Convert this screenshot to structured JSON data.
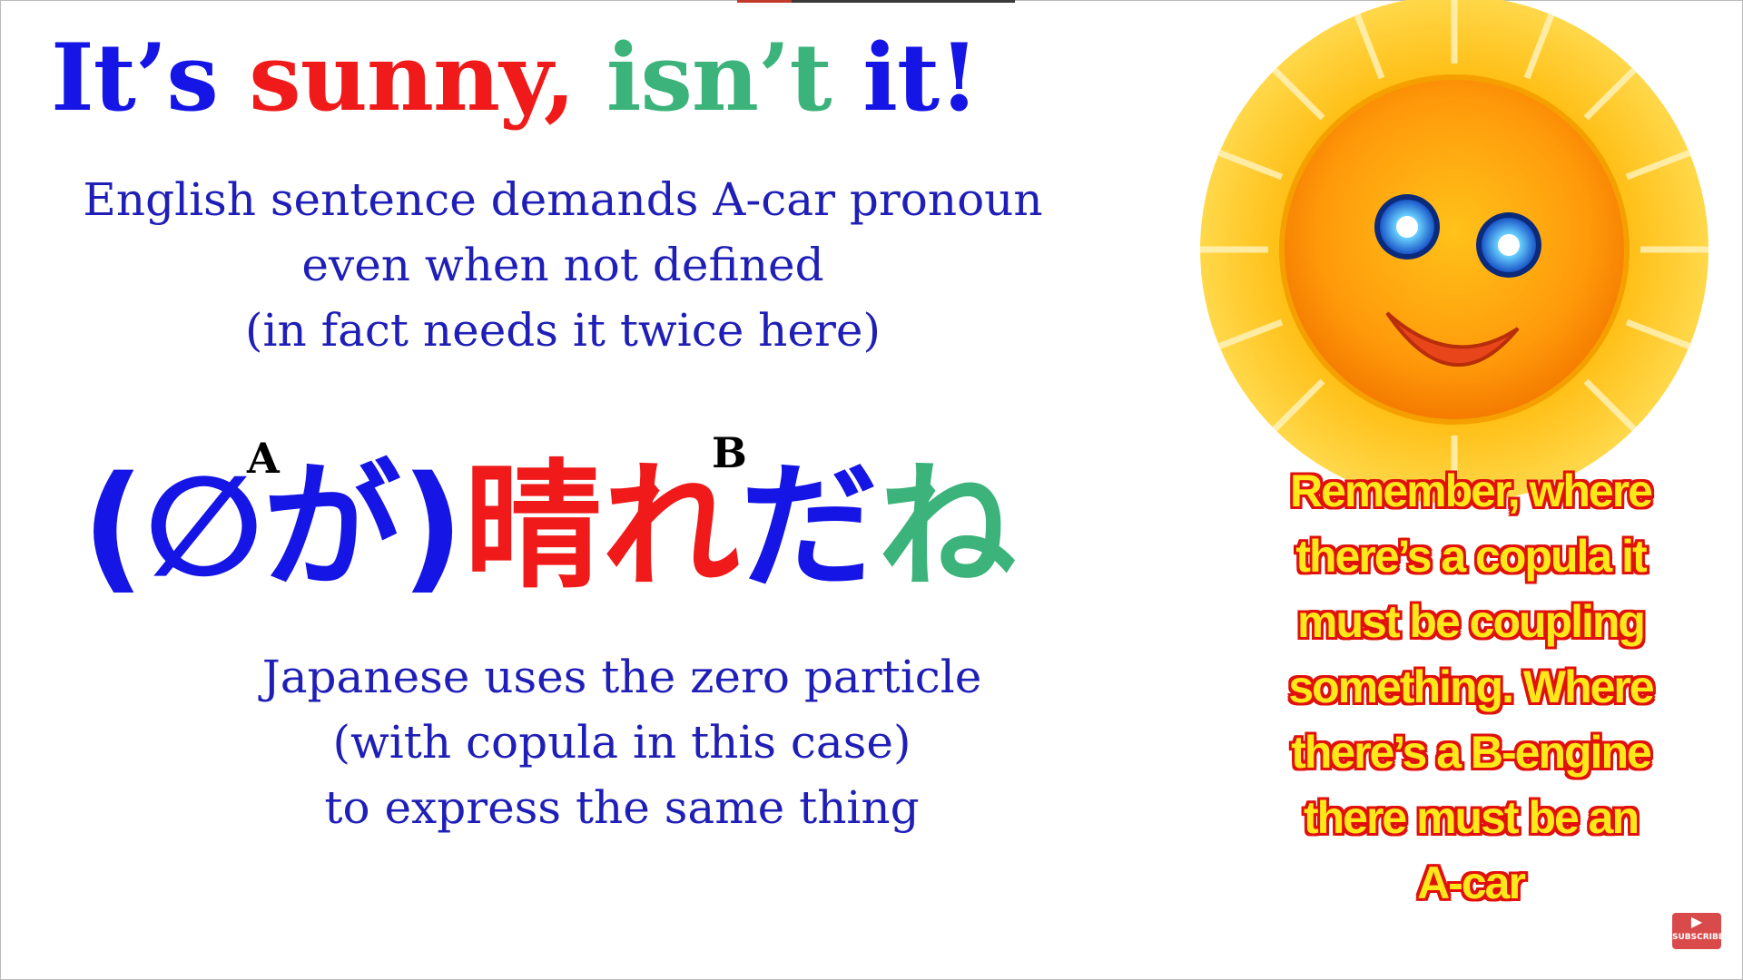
{
  "title": {
    "part1": "It’s",
    "part2": "sunny,",
    "part3": "isn’t",
    "part4": "it!"
  },
  "english_note": {
    "line1": "English sentence demands A-car pronoun",
    "line2": "even when not defined",
    "line3": "(in fact needs it twice here)"
  },
  "japanese_sentence": {
    "open_paren": "(",
    "zero_particle": "∅",
    "ga": "が",
    "close_paren": ")",
    "hare": "晴れ",
    "da": "だ",
    "ne": "ね",
    "marker_a": "A",
    "marker_b": "B"
  },
  "japanese_note": {
    "line1": "Japanese uses the zero particle",
    "line2": "(with copula in this case)",
    "line3": "to express the same thing"
  },
  "callout": {
    "lines": [
      "Remember, where",
      "there’s a copula it",
      "must be coupling",
      "something. Where",
      "there’s a B-engine",
      "there must be an",
      "A-car"
    ]
  },
  "subscribe": {
    "label": "SUBSCRIBE",
    "icon": "play-icon"
  },
  "colors": {
    "blue": "#1515e6",
    "red": "#f01a1a",
    "green": "#3bb37a",
    "note_blue": "#1f1fb8",
    "callout_fill": "#ffe81a",
    "callout_outline": "#e0100c"
  },
  "illustration": {
    "icon": "smiling-sun-icon"
  }
}
